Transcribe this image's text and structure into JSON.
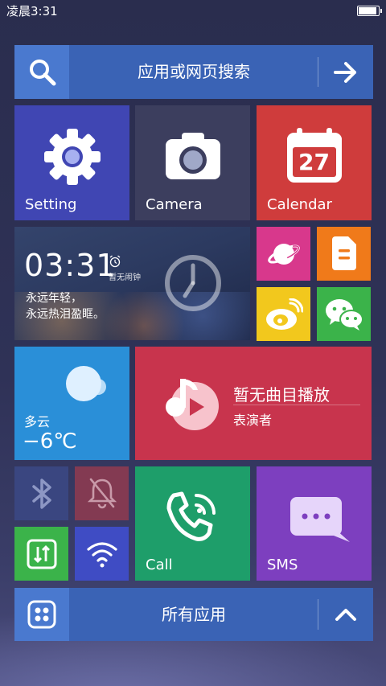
{
  "status_bar": {
    "time": "凌晨3:31"
  },
  "search": {
    "label": "应用或网页搜索"
  },
  "tiles": {
    "setting": "Setting",
    "camera": "Camera",
    "calendar": {
      "label": "Calendar",
      "day": "27"
    },
    "clock": {
      "time": "03:31",
      "alarm": "暂无闹钟",
      "line1": "永远年轻，",
      "line2": "永远热泪盈眶。"
    },
    "weather": {
      "condition": "多云",
      "temperature": "−6℃"
    },
    "music": {
      "title": "暂无曲目播放",
      "artist": "表演者"
    },
    "call": "Call",
    "sms": "SMS"
  },
  "all_apps": {
    "label": "所有应用"
  },
  "icons": [
    "search-icon",
    "arrow-right-icon",
    "gear-icon",
    "camera-icon",
    "calendar-icon",
    "alarm-icon",
    "planet-icon",
    "notes-icon",
    "weibo-icon",
    "wechat-icon",
    "weather-cloud-icon",
    "music-note-icon",
    "bluetooth-icon",
    "mute-bell-icon",
    "data-transfer-icon",
    "wifi-icon",
    "phone-icon",
    "sms-icon",
    "apps-grid-icon",
    "chevron-up-icon"
  ]
}
